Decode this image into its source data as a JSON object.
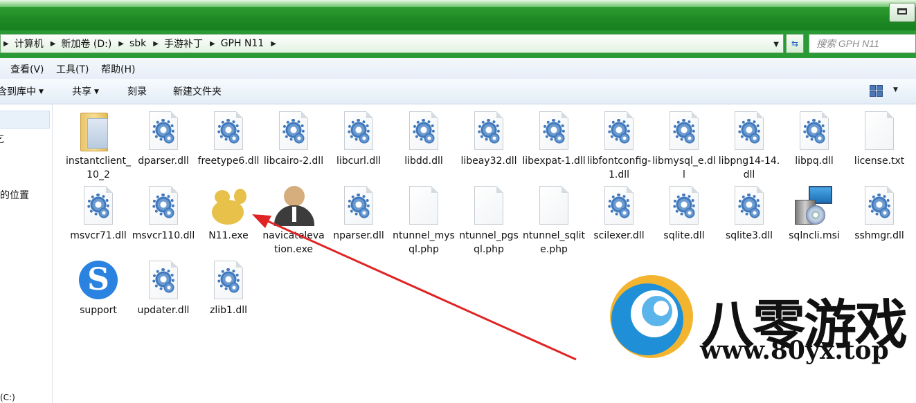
{
  "address": {
    "crumbs": [
      "计算机",
      "新加卷 (D:)",
      "sbk",
      "手游补丁",
      "GPH N11"
    ]
  },
  "search": {
    "placeholder": "搜索 GPH N11"
  },
  "menu": [
    "查看(V)",
    "工具(T)",
    "帮助(H)"
  ],
  "toolbar": {
    "include_library": "含到库中",
    "share": "共享",
    "burn": "刻录",
    "new_folder": "新建文件夹"
  },
  "nav": [
    "乞",
    "的位置",
    "(C:)"
  ],
  "files": [
    {
      "name": "instantclient_10_2",
      "icon": "folder-icon"
    },
    {
      "name": "dparser.dll",
      "icon": "dll-gear-icon"
    },
    {
      "name": "freetype6.dll",
      "icon": "dll-gear-icon"
    },
    {
      "name": "libcairo-2.dll",
      "icon": "dll-gear-icon"
    },
    {
      "name": "libcurl.dll",
      "icon": "dll-gear-icon"
    },
    {
      "name": "libdd.dll",
      "icon": "dll-gear-icon"
    },
    {
      "name": "libeay32.dll",
      "icon": "dll-gear-icon"
    },
    {
      "name": "libexpat-1.dll",
      "icon": "dll-gear-icon"
    },
    {
      "name": "libfontconfig-1.dll",
      "icon": "dll-gear-icon"
    },
    {
      "name": "libmysql_e.dll",
      "icon": "dll-gear-icon"
    },
    {
      "name": "libpng14-14.dll",
      "icon": "dll-gear-icon"
    },
    {
      "name": "libpq.dll",
      "icon": "dll-gear-icon"
    },
    {
      "name": "license.txt",
      "icon": "text-file-icon"
    },
    {
      "name": "msvcr71.dll",
      "icon": "dll-gear-icon"
    },
    {
      "name": "msvcr110.dll",
      "icon": "dll-gear-icon"
    },
    {
      "name": "N11.exe",
      "icon": "n11-app-icon"
    },
    {
      "name": "navicatelevation.exe",
      "icon": "user-avatar-icon"
    },
    {
      "name": "nparser.dll",
      "icon": "dll-gear-icon"
    },
    {
      "name": "ntunnel_mysql.php",
      "icon": "php-file-icon"
    },
    {
      "name": "ntunnel_pgsql.php",
      "icon": "php-file-icon"
    },
    {
      "name": "ntunnel_sqlite.php",
      "icon": "php-file-icon"
    },
    {
      "name": "scilexer.dll",
      "icon": "dll-gear-icon"
    },
    {
      "name": "sqlite.dll",
      "icon": "dll-gear-icon"
    },
    {
      "name": "sqlite3.dll",
      "icon": "dll-gear-icon"
    },
    {
      "name": "sqlncli.msi",
      "icon": "msi-installer-icon"
    },
    {
      "name": "sshmgr.dll",
      "icon": "dll-gear-icon"
    },
    {
      "name": "support",
      "icon": "support-s-icon"
    },
    {
      "name": "updater.dll",
      "icon": "dll-gear-icon"
    },
    {
      "name": "zlib1.dll",
      "icon": "dll-gear-icon"
    }
  ],
  "watermark": {
    "brand": "八零游戏",
    "url": "www.80yx.top"
  },
  "colors": {
    "titlebar": "#1f8a24",
    "arrow": "#e02424"
  }
}
